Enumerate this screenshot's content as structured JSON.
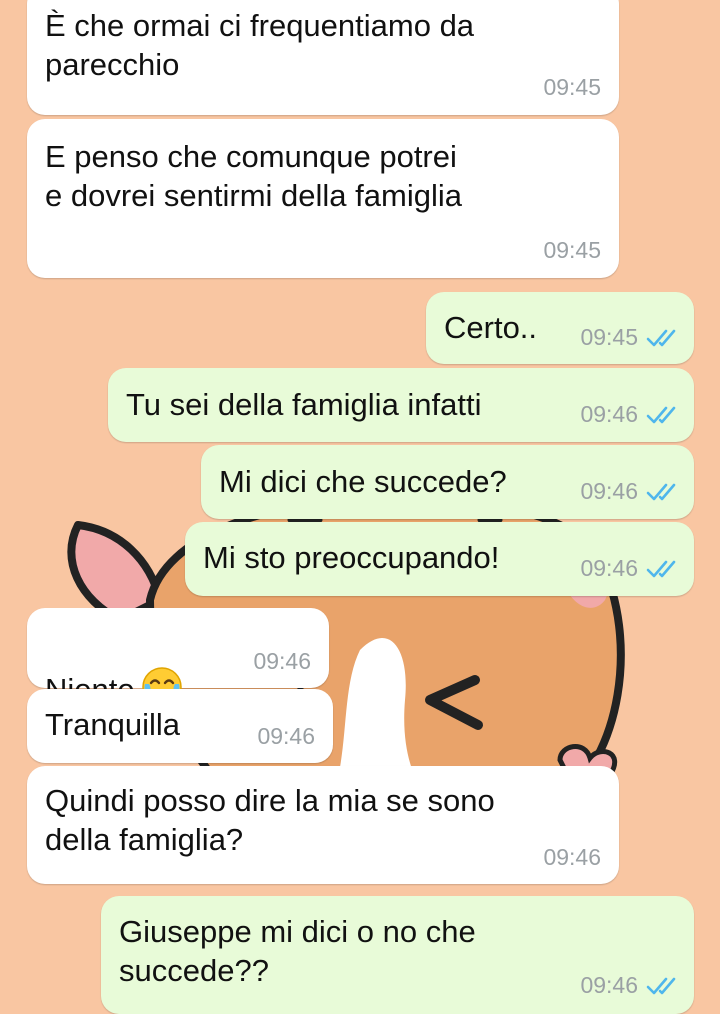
{
  "colors": {
    "background": "#f9c6a2",
    "incoming_bubble": "#ffffff",
    "outgoing_bubble": "#e8fbd8",
    "timestamp": "#9aa0a4",
    "read_ticks": "#4fb6ec"
  },
  "messages": [
    {
      "direction": "incoming",
      "text": "È che ormai ci frequentiamo da\nparecchio",
      "time": "09:45"
    },
    {
      "direction": "incoming",
      "text": "E penso che comunque potrei\ne dovrei sentirmi della famiglia",
      "time": "09:45"
    },
    {
      "direction": "outgoing",
      "text": "Certo..",
      "time": "09:45",
      "status": "read"
    },
    {
      "direction": "outgoing",
      "text": "Tu sei della famiglia infatti",
      "time": "09:46",
      "status": "read"
    },
    {
      "direction": "outgoing",
      "text": "Mi dici che succede?",
      "time": "09:46",
      "status": "read"
    },
    {
      "direction": "outgoing",
      "text": "Mi sto preoccupando!",
      "time": "09:46",
      "status": "read"
    },
    {
      "direction": "incoming",
      "text": "Niente",
      "emoji": "face-with-tears-of-joy",
      "time": "09:46"
    },
    {
      "direction": "incoming",
      "text": "Tranquilla",
      "time": "09:46"
    },
    {
      "direction": "incoming",
      "text": "Quindi posso dire la mia se sono\ndella famiglia?",
      "time": "09:46"
    },
    {
      "direction": "outgoing",
      "text": "Giuseppe mi dici o no che\nsuccede??",
      "time": "09:46",
      "status": "read"
    }
  ]
}
